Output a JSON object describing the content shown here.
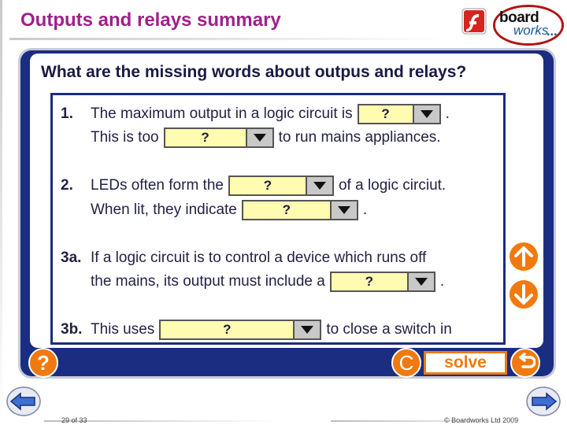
{
  "slide": {
    "title": "Outputs and relays summary"
  },
  "logo": {
    "board": "board",
    "works": "works",
    "dots": "•••"
  },
  "activity": {
    "question": "What are the missing words about outpus and relays?",
    "q1": {
      "number": "1.",
      "line1_before": "The maximum output in a logic circuit is",
      "line1_dropdown": "?",
      "line1_after": ".",
      "line2_before": "This is too",
      "line2_dropdown": "?",
      "line2_after": "to run mains appliances."
    },
    "q2": {
      "number": "2.",
      "line1_before": "LEDs often form the",
      "line1_dropdown": "?",
      "line1_after": "of a logic circiut.",
      "line2_before": "When lit, they indicate",
      "line2_dropdown": "?",
      "line2_after": "."
    },
    "q3a": {
      "number": "3a.",
      "line1": "If a logic circuit is to control a device which runs off",
      "line2_before": "the mains, its output must include a",
      "line2_dropdown": "?",
      "line2_after": "."
    },
    "q3b": {
      "number": "3b.",
      "line1_before": "This uses",
      "line1_dropdown": "?",
      "line1_after": "to close a switch in"
    }
  },
  "controls": {
    "help_label": "?",
    "clear_label": "C",
    "solve_label": "solve"
  },
  "footer": {
    "page": "29 of 33",
    "copyright": "© Boardworks Ltd 2009"
  },
  "colors": {
    "title": "#a0208a",
    "panel": "#1a2d80",
    "accent": "#f07a10",
    "dropdown_fill": "#fffbb0"
  },
  "icons": {
    "flash": "flash-icon",
    "scroll_up": "arrow-up-icon",
    "scroll_down": "arrow-down-icon",
    "reset": "undo-icon",
    "prev": "prev-arrow-icon",
    "next": "next-arrow-icon"
  }
}
